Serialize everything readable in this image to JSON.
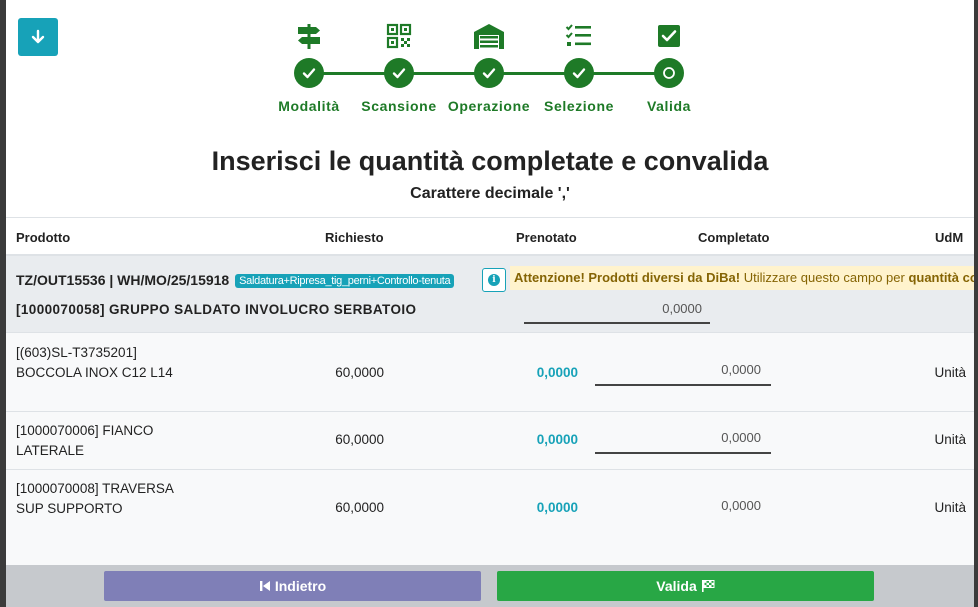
{
  "colors": {
    "accent": "#17a2b8",
    "step_green": "#1e7a27",
    "back_button": "#7f7fb7",
    "confirm_button": "#28a745",
    "warning_bg": "#fff3cd"
  },
  "steps": [
    {
      "label": "Modalità",
      "icon": "signpost-icon",
      "status": "done"
    },
    {
      "label": "Scansione",
      "icon": "qr-code-icon",
      "status": "done"
    },
    {
      "label": "Operazione",
      "icon": "warehouse-icon",
      "status": "done"
    },
    {
      "label": "Selezione",
      "icon": "checklist-icon",
      "status": "done"
    },
    {
      "label": "Valida",
      "icon": "check-square-icon",
      "status": "current"
    }
  ],
  "heading": {
    "title": "Inserisci le quantità completate e convalida",
    "subtitle": "Carattere decimale ','"
  },
  "table": {
    "headers": {
      "product": "Prodotto",
      "requested": "Richiesto",
      "reserved": "Prenotato",
      "completed": "Completato",
      "uom": "UdM"
    },
    "group": {
      "ref": "TZ/OUT15536 | WH/MO/25/15918",
      "badge": "Saldatura+Ripresa_tig_perni+Controllo-tenuta",
      "warning_bold": "Attenzione! Prodotti diversi da DiBa!",
      "warning_text": " Utilizzare questo campo per ",
      "warning_tail": "quantità co",
      "name": "[1000070058] GRUPPO SALDATO INVOLUCRO SERBATOIO",
      "quantity": "0,0000"
    },
    "rows": [
      {
        "line1": "[(603)SL-T3735201]",
        "line2": "BOCCOLA INOX C12 L14",
        "requested": "60,0000",
        "reserved": "0,0000",
        "completed": "0,0000",
        "uom": "Unità"
      },
      {
        "line1": "[1000070006] FIANCO",
        "line2": "LATERALE",
        "requested": "60,0000",
        "reserved": "0,0000",
        "completed": "0,0000",
        "uom": "Unità"
      },
      {
        "line1": "[1000070008] TRAVERSA",
        "line2": "SUP SUPPORTO",
        "requested": "60,0000",
        "reserved": "0,0000",
        "completed": "0,0000",
        "uom": "Unità"
      }
    ]
  },
  "footer": {
    "back_label": "Indietro",
    "confirm_label": "Valida"
  }
}
